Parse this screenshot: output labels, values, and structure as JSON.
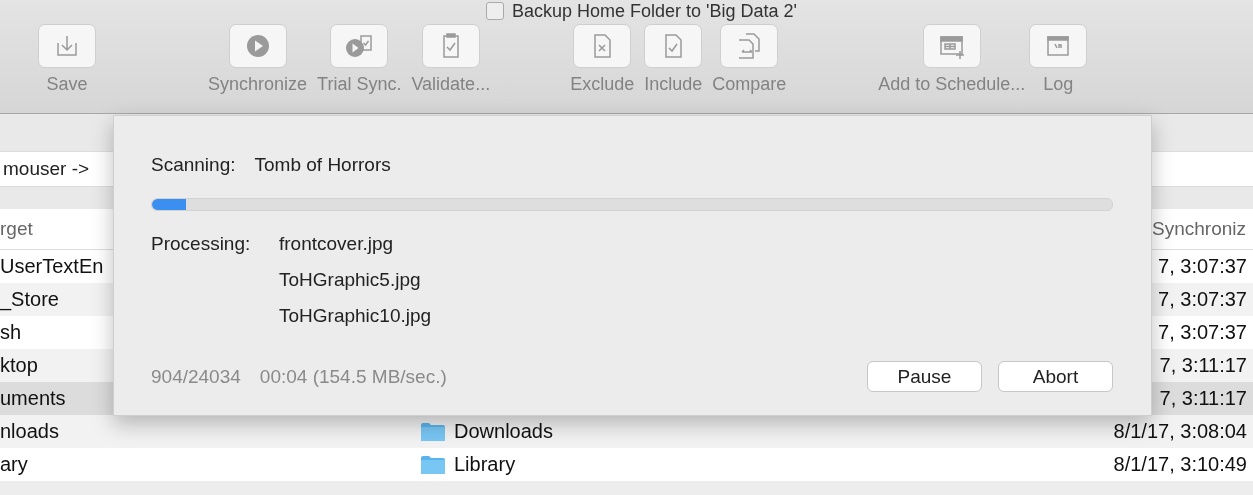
{
  "window": {
    "title": "Backup Home Folder to 'Big Data 2'"
  },
  "toolbar": {
    "groups": [
      [
        {
          "label": "Save"
        }
      ],
      [
        {
          "label": "Synchronize"
        },
        {
          "label": "Trial Sync."
        },
        {
          "label": "Validate..."
        }
      ],
      [
        {
          "label": "Exclude"
        },
        {
          "label": "Include"
        },
        {
          "label": "Compare"
        }
      ],
      [
        {
          "label": "Add to Schedule..."
        }
      ],
      [
        {
          "label": "Log"
        }
      ]
    ]
  },
  "path": "mouser ->",
  "table": {
    "columns": [
      "rget",
      "Synchroniz"
    ],
    "rows": [
      {
        "source": "UserTextEn",
        "item": "",
        "synced": "7, 3:07:37",
        "selected": false
      },
      {
        "source": "_Store",
        "item": "",
        "synced": "7, 3:07:37",
        "selected": false
      },
      {
        "source": "sh",
        "item": "",
        "synced": "7, 3:07:37",
        "selected": false
      },
      {
        "source": "ktop",
        "item": "",
        "synced": "7, 3:11:17",
        "selected": false
      },
      {
        "source": "uments",
        "item": "",
        "synced": "7, 3:11:17",
        "selected": true
      },
      {
        "source": "nloads",
        "item": "Downloads",
        "synced": "8/1/17, 3:08:04",
        "selected": false
      },
      {
        "source": "ary",
        "item": "Library",
        "synced": "8/1/17, 3:10:49",
        "selected": false
      }
    ]
  },
  "dialog": {
    "scanning_label": "Scanning:",
    "scanning_value": "Tomb of Horrors",
    "progress": {
      "level": 0.035
    },
    "processing_label": "Processing:",
    "files": [
      "frontcover.jpg",
      "ToHGraphic5.jpg",
      "ToHGraphic10.jpg"
    ],
    "count": "904/24034",
    "elapsed": "00:04 (154.5 MB/sec.)",
    "buttons": [
      "Pause",
      "Abort"
    ]
  }
}
